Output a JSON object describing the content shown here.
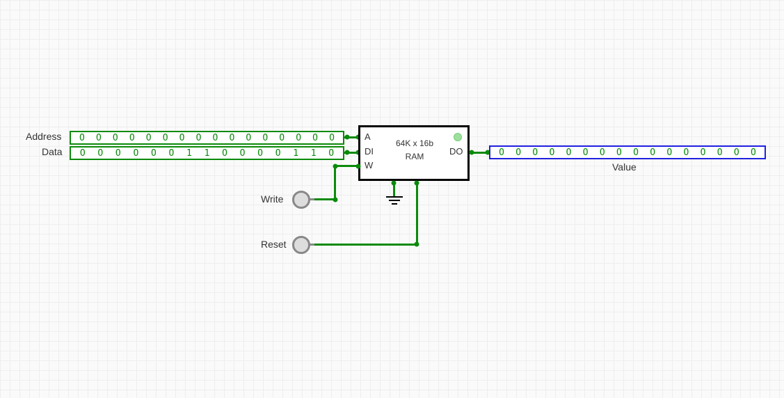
{
  "labels": {
    "address": "Address",
    "data": "Data",
    "write": "Write",
    "reset": "Reset",
    "value": "Value"
  },
  "ram": {
    "title_line1": "64K x 16b",
    "title_line2": "RAM",
    "pins": {
      "a": "A",
      "di": "DI",
      "w": "W",
      "do": "DO"
    }
  },
  "registers": {
    "address_bits": [
      "O",
      "O",
      "O",
      "O",
      "O",
      "O",
      "O",
      "O",
      "O",
      "O",
      "O",
      "O",
      "O",
      "O",
      "O",
      "O"
    ],
    "data_bits": [
      "O",
      "O",
      "O",
      "O",
      "O",
      "O",
      "1",
      "1",
      "O",
      "O",
      "O",
      "O",
      "1",
      "1",
      "O"
    ],
    "value_bits": [
      "O",
      "O",
      "O",
      "O",
      "O",
      "O",
      "O",
      "O",
      "O",
      "O",
      "O",
      "O",
      "O",
      "O",
      "O",
      "O"
    ]
  },
  "colors": {
    "wire": "#0a8a0a",
    "box_green": "#0a8a0a",
    "box_blue": "#2020e0"
  }
}
